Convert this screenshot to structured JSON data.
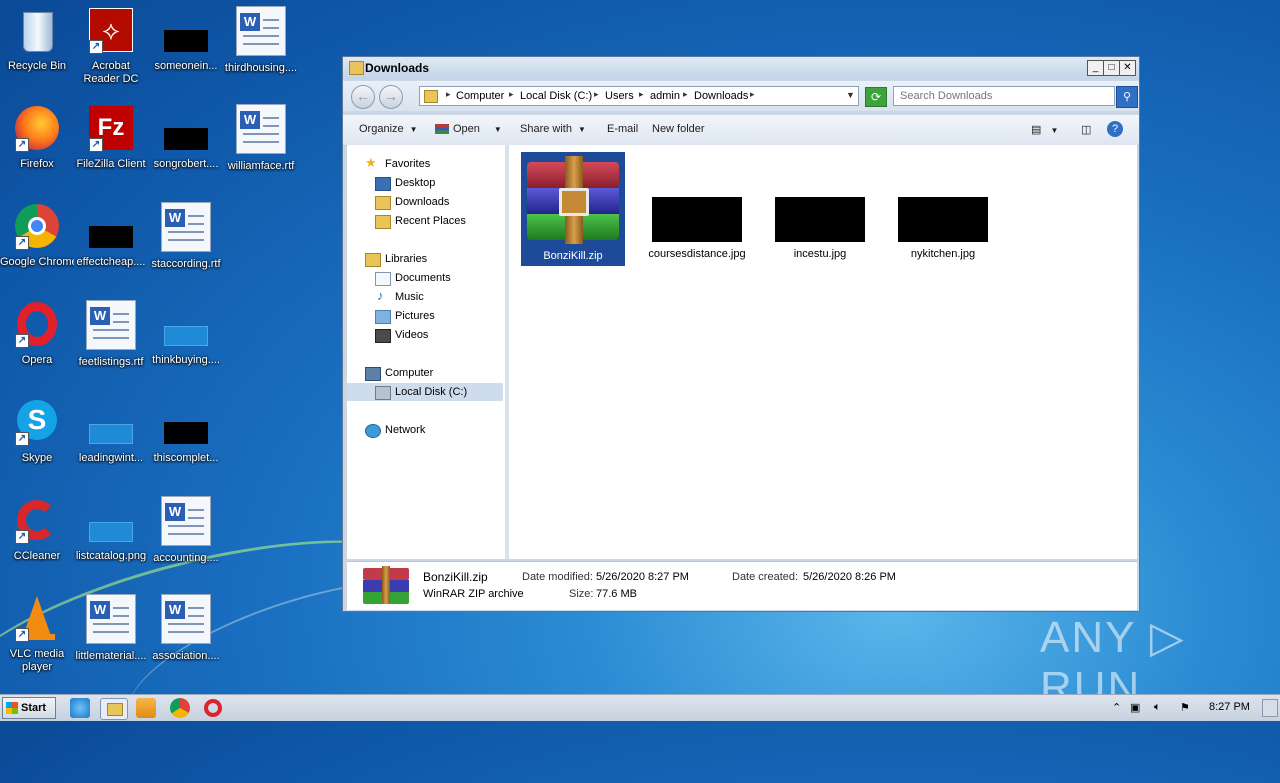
{
  "desktop": {
    "icons": [
      {
        "label": "Recycle Bin"
      },
      {
        "label": "Acrobat Reader DC"
      },
      {
        "label": "someonein..."
      },
      {
        "label": "thirdhousing...."
      },
      {
        "label": "Firefox"
      },
      {
        "label": "FileZilla Client"
      },
      {
        "label": "songrobert...."
      },
      {
        "label": "williamface.rtf"
      },
      {
        "label": "Google Chrome"
      },
      {
        "label": "effectcheap...."
      },
      {
        "label": "staccording.rtf"
      },
      {
        "label": "Opera"
      },
      {
        "label": "feetlistings.rtf"
      },
      {
        "label": "thinkbuying...."
      },
      {
        "label": "Skype"
      },
      {
        "label": "leadingwint..."
      },
      {
        "label": "thiscomplet..."
      },
      {
        "label": "CCleaner"
      },
      {
        "label": "listcatalog.png"
      },
      {
        "label": "accounting...."
      },
      {
        "label": "VLC media player"
      },
      {
        "label": "littlematerial...."
      },
      {
        "label": "association...."
      }
    ]
  },
  "window": {
    "title": "Downloads",
    "controls": {
      "minimize": "_",
      "maximize": "□",
      "close": "✕"
    },
    "address": {
      "crumbs": [
        "Computer",
        "Local Disk (C:)",
        "Users",
        "admin",
        "Downloads"
      ]
    },
    "search": {
      "placeholder": "Search Downloads"
    },
    "toolbar": {
      "organize": "Organize",
      "open": "Open",
      "share_with": "Share with",
      "email": "E-mail",
      "new_folder": "New folder"
    },
    "nav": {
      "favorites": "Favorites",
      "desktop": "Desktop",
      "downloads": "Downloads",
      "recent": "Recent Places",
      "libraries": "Libraries",
      "documents": "Documents",
      "music": "Music",
      "pictures": "Pictures",
      "videos": "Videos",
      "computer": "Computer",
      "local_disk": "Local Disk (C:)",
      "network": "Network"
    },
    "files": [
      {
        "name": "BonziKill.zip"
      },
      {
        "name": "coursesdistance.jpg"
      },
      {
        "name": "incestu.jpg"
      },
      {
        "name": "nykitchen.jpg"
      }
    ],
    "details": {
      "name": "BonziKill.zip",
      "type": "WinRAR ZIP archive",
      "modified_label": "Date modified:",
      "modified": "5/26/2020 8:27 PM",
      "created_label": "Date created:",
      "created": "5/26/2020 8:26 PM",
      "size_label": "Size:",
      "size": "77.6 MB"
    }
  },
  "taskbar": {
    "start": "Start",
    "clock": "8:27 PM"
  },
  "watermark": "ANY ▷ RUN"
}
